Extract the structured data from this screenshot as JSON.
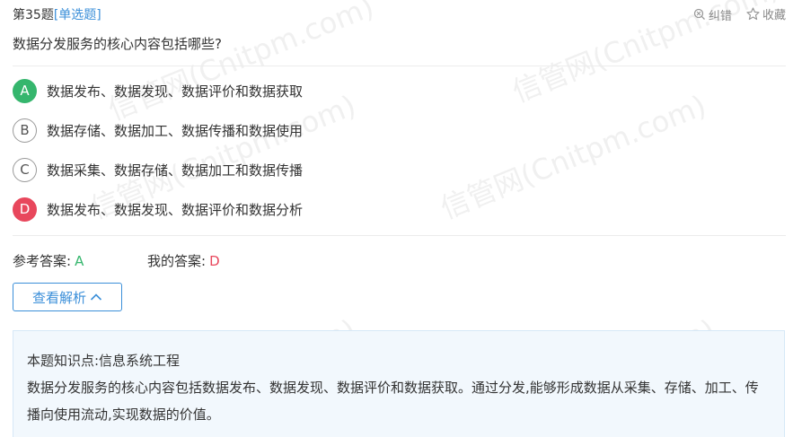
{
  "header": {
    "question_number": "第35题",
    "question_type": "[单选题]",
    "report_label": "纠错",
    "favorite_label": "收藏"
  },
  "question": {
    "text": "数据分发服务的核心内容包括哪些?"
  },
  "options": [
    {
      "letter": "A",
      "text": "数据发布、数据发现、数据评价和数据获取",
      "state": "correct"
    },
    {
      "letter": "B",
      "text": "数据存储、数据加工、数据传播和数据使用",
      "state": "normal"
    },
    {
      "letter": "C",
      "text": "数据采集、数据存储、数据加工和数据传播",
      "state": "normal"
    },
    {
      "letter": "D",
      "text": "数据发布、数据发现、数据评价和数据分析",
      "state": "wrong"
    }
  ],
  "answers": {
    "reference_label": "参考答案:",
    "reference_value": "A",
    "mine_label": "我的答案:",
    "mine_value": "D"
  },
  "view_analysis_button": "查看解析",
  "analysis": {
    "knowledge_point": "本题知识点:信息系统工程",
    "body": "数据分发服务的核心内容包括数据发布、数据发现、数据评价和数据获取。通过分发,能够形成数据从采集、存储、加工、传播向使用流动,实现数据的价值。"
  },
  "watermark": "信管网(Cnitpm.com)",
  "colors": {
    "accent": "#3b8fd9",
    "correct": "#35b66d",
    "wrong": "#e8475c",
    "analysis_bg": "#f2f8fd"
  }
}
